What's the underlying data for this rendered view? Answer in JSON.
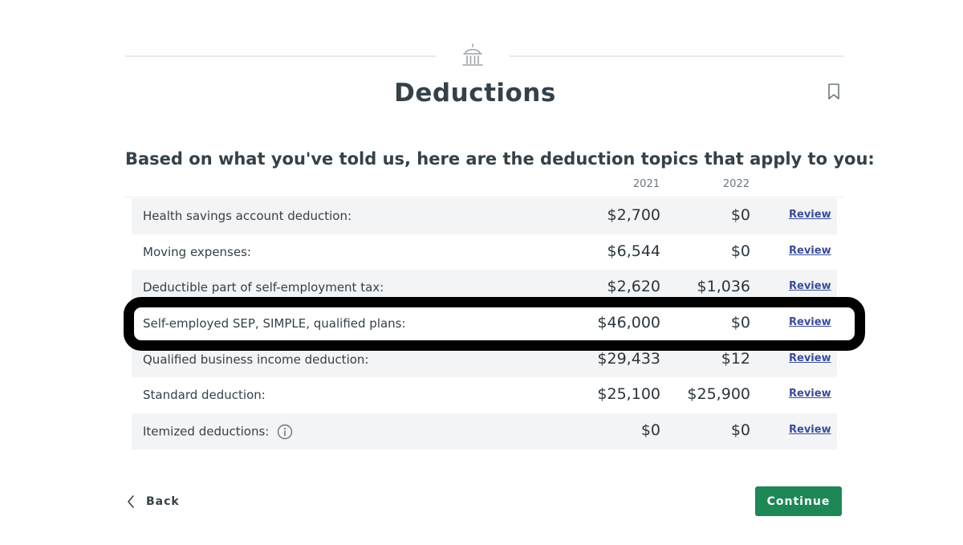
{
  "header": {
    "icon": "capitol-building-icon",
    "title": "Deductions",
    "bookmark_icon": "bookmark-icon"
  },
  "intro": "Based on what you've told us, here are the deduction topics that apply to you:",
  "columns": {
    "year1": "2021",
    "year2": "2022"
  },
  "rows": [
    {
      "label": "Health savings account deduction:",
      "amount_2021": "$2,700",
      "amount_2022": "$0",
      "action": "Review"
    },
    {
      "label": "Moving expenses:",
      "amount_2021": "$6,544",
      "amount_2022": "$0",
      "action": "Review"
    },
    {
      "label": "Deductible part of self-employment tax:",
      "amount_2021": "$2,620",
      "amount_2022": "$1,036",
      "action": "Review"
    },
    {
      "label": "Self-employed SEP, SIMPLE, qualified plans:",
      "amount_2021": "$46,000",
      "amount_2022": "$0",
      "action": "Review",
      "highlighted": true
    },
    {
      "label": "Qualified business income deduction:",
      "amount_2021": "$29,433",
      "amount_2022": "$12",
      "action": "Review"
    },
    {
      "label": "Standard deduction:",
      "amount_2021": "$25,100",
      "amount_2022": "$25,900",
      "action": "Review"
    },
    {
      "label": "Itemized deductions:",
      "amount_2021": "$0",
      "amount_2022": "$0",
      "action": "Review",
      "info_icon": "info-icon"
    }
  ],
  "footer": {
    "back_label": "Back",
    "continue_label": "Continue"
  },
  "colors": {
    "primary_button": "#1e8756",
    "link": "#3b4c9b",
    "row_shade": "#f3f4f6",
    "highlight_border": "#000000",
    "text": "#354148"
  }
}
